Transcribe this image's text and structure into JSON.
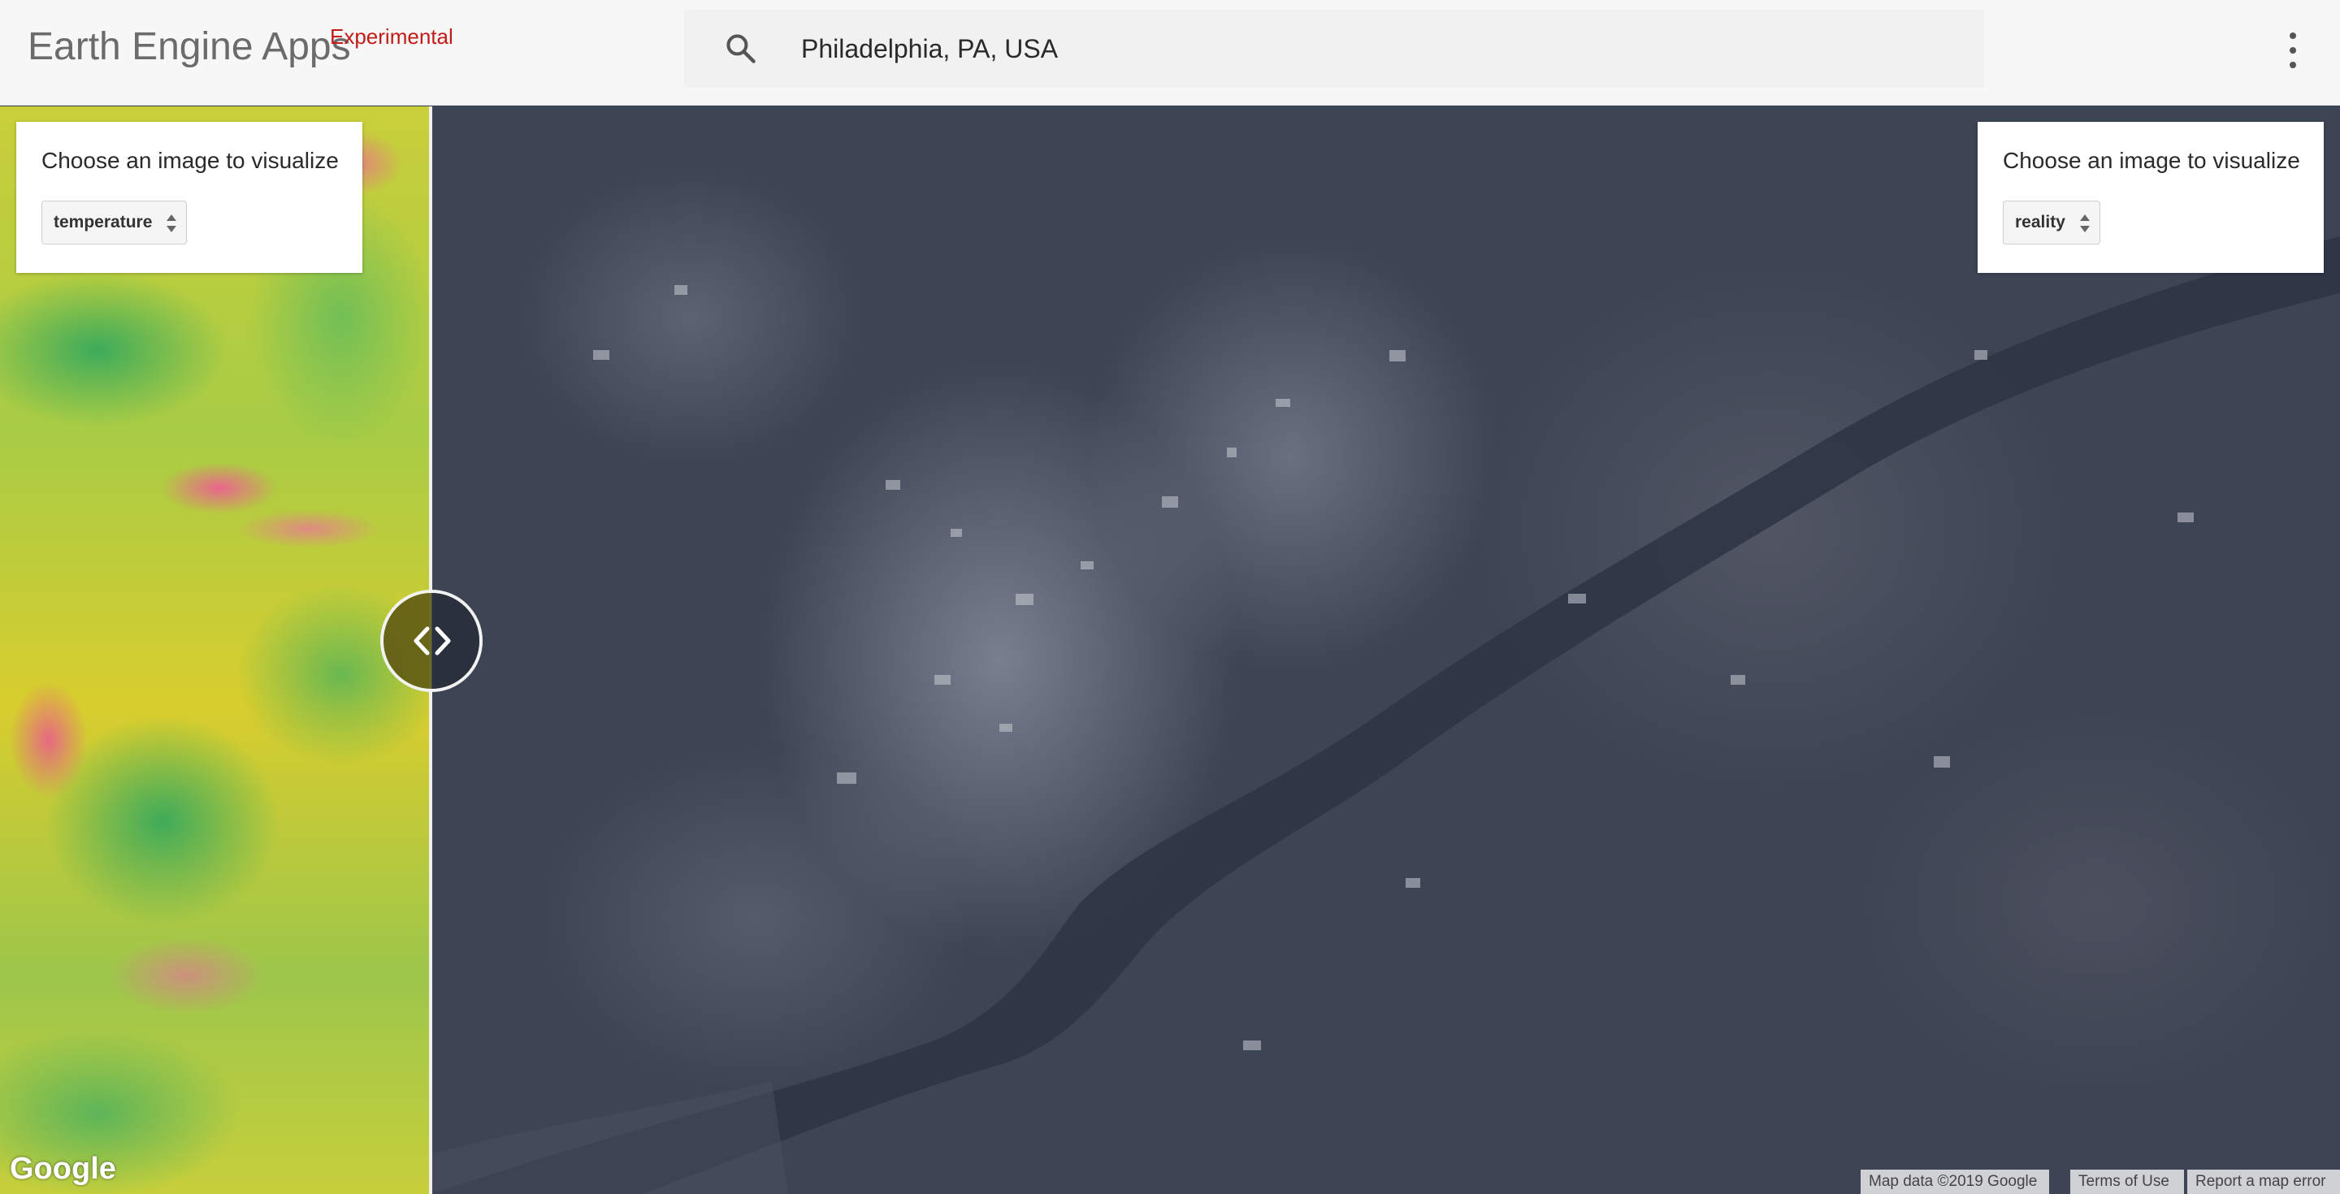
{
  "header": {
    "app_title": "Earth Engine Apps",
    "badge": "Experimental",
    "search": {
      "value": "Philadelphia, PA, USA",
      "icon": "search-icon"
    },
    "menu_icon": "more-vert-icon"
  },
  "left_panel": {
    "label": "Choose an image to visualize",
    "selected": "temperature"
  },
  "right_panel": {
    "label": "Choose an image to visualize",
    "selected": "reality"
  },
  "split_handle": {
    "icon": "chevron-left-right-icon"
  },
  "map": {
    "logo": "Google",
    "attribution": {
      "map_data": "Map data ©2019 Google",
      "terms": "Terms of Use",
      "report": "Report a map error"
    }
  },
  "colors": {
    "badge": "#c21b17",
    "header_bg": "#f7f7f7",
    "map_dark": "#3d4454"
  }
}
